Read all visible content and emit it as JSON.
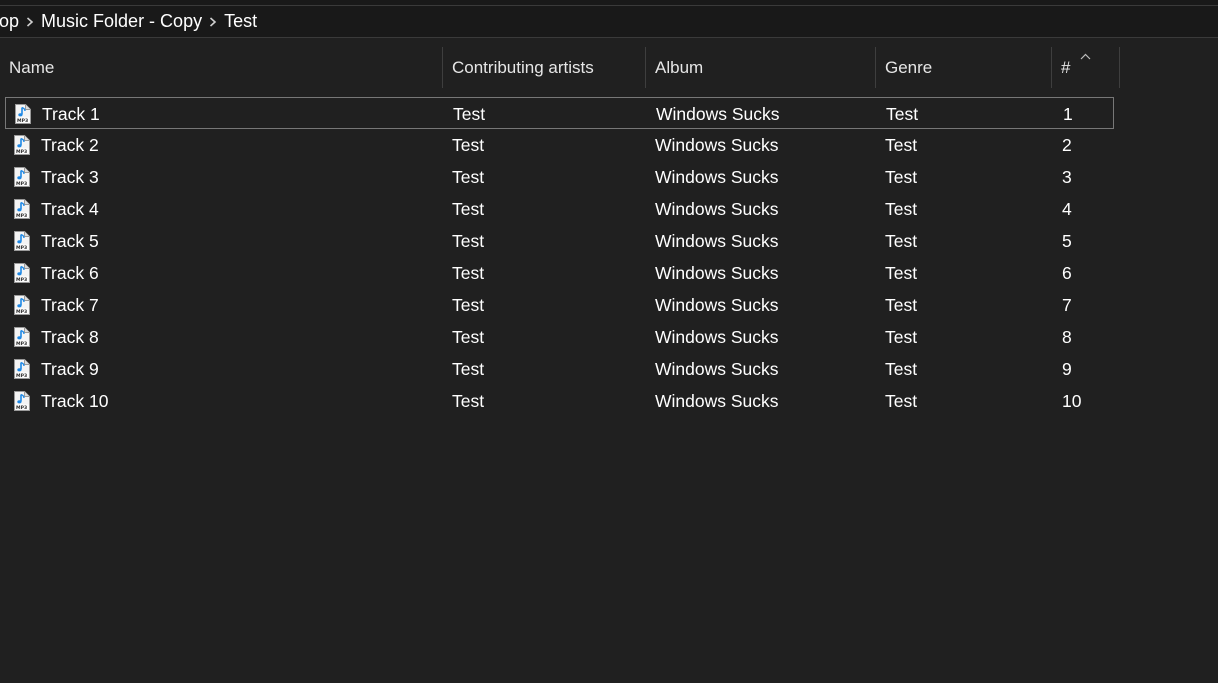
{
  "breadcrumb": [
    "top",
    "Music Folder - Copy",
    "Test"
  ],
  "columns": [
    "Name",
    "Contributing artists",
    "Album",
    "Genre",
    "#"
  ],
  "rows": [
    {
      "name": "Track 1",
      "artist": "Test",
      "album": "Windows Sucks",
      "genre": "Test",
      "number": "1"
    },
    {
      "name": "Track 2",
      "artist": "Test",
      "album": "Windows Sucks",
      "genre": "Test",
      "number": "2"
    },
    {
      "name": "Track 3",
      "artist": "Test",
      "album": "Windows Sucks",
      "genre": "Test",
      "number": "3"
    },
    {
      "name": "Track 4",
      "artist": "Test",
      "album": "Windows Sucks",
      "genre": "Test",
      "number": "4"
    },
    {
      "name": "Track 5",
      "artist": "Test",
      "album": "Windows Sucks",
      "genre": "Test",
      "number": "5"
    },
    {
      "name": "Track 6",
      "artist": "Test",
      "album": "Windows Sucks",
      "genre": "Test",
      "number": "6"
    },
    {
      "name": "Track 7",
      "artist": "Test",
      "album": "Windows Sucks",
      "genre": "Test",
      "number": "7"
    },
    {
      "name": "Track 8",
      "artist": "Test",
      "album": "Windows Sucks",
      "genre": "Test",
      "number": "8"
    },
    {
      "name": "Track 9",
      "artist": "Test",
      "album": "Windows Sucks",
      "genre": "Test",
      "number": "9"
    },
    {
      "name": "Track 10",
      "artist": "Test",
      "album": "Windows Sucks",
      "genre": "Test",
      "number": "10"
    }
  ],
  "icons": {
    "file": "mp3-file-icon",
    "separator": "chevron-right-icon",
    "sort": "chevron-up-icon"
  },
  "colors": {
    "background": "#202020",
    "address_bar": "#191919",
    "text": "#ffffff",
    "icon_accent": "#1e88e5"
  }
}
